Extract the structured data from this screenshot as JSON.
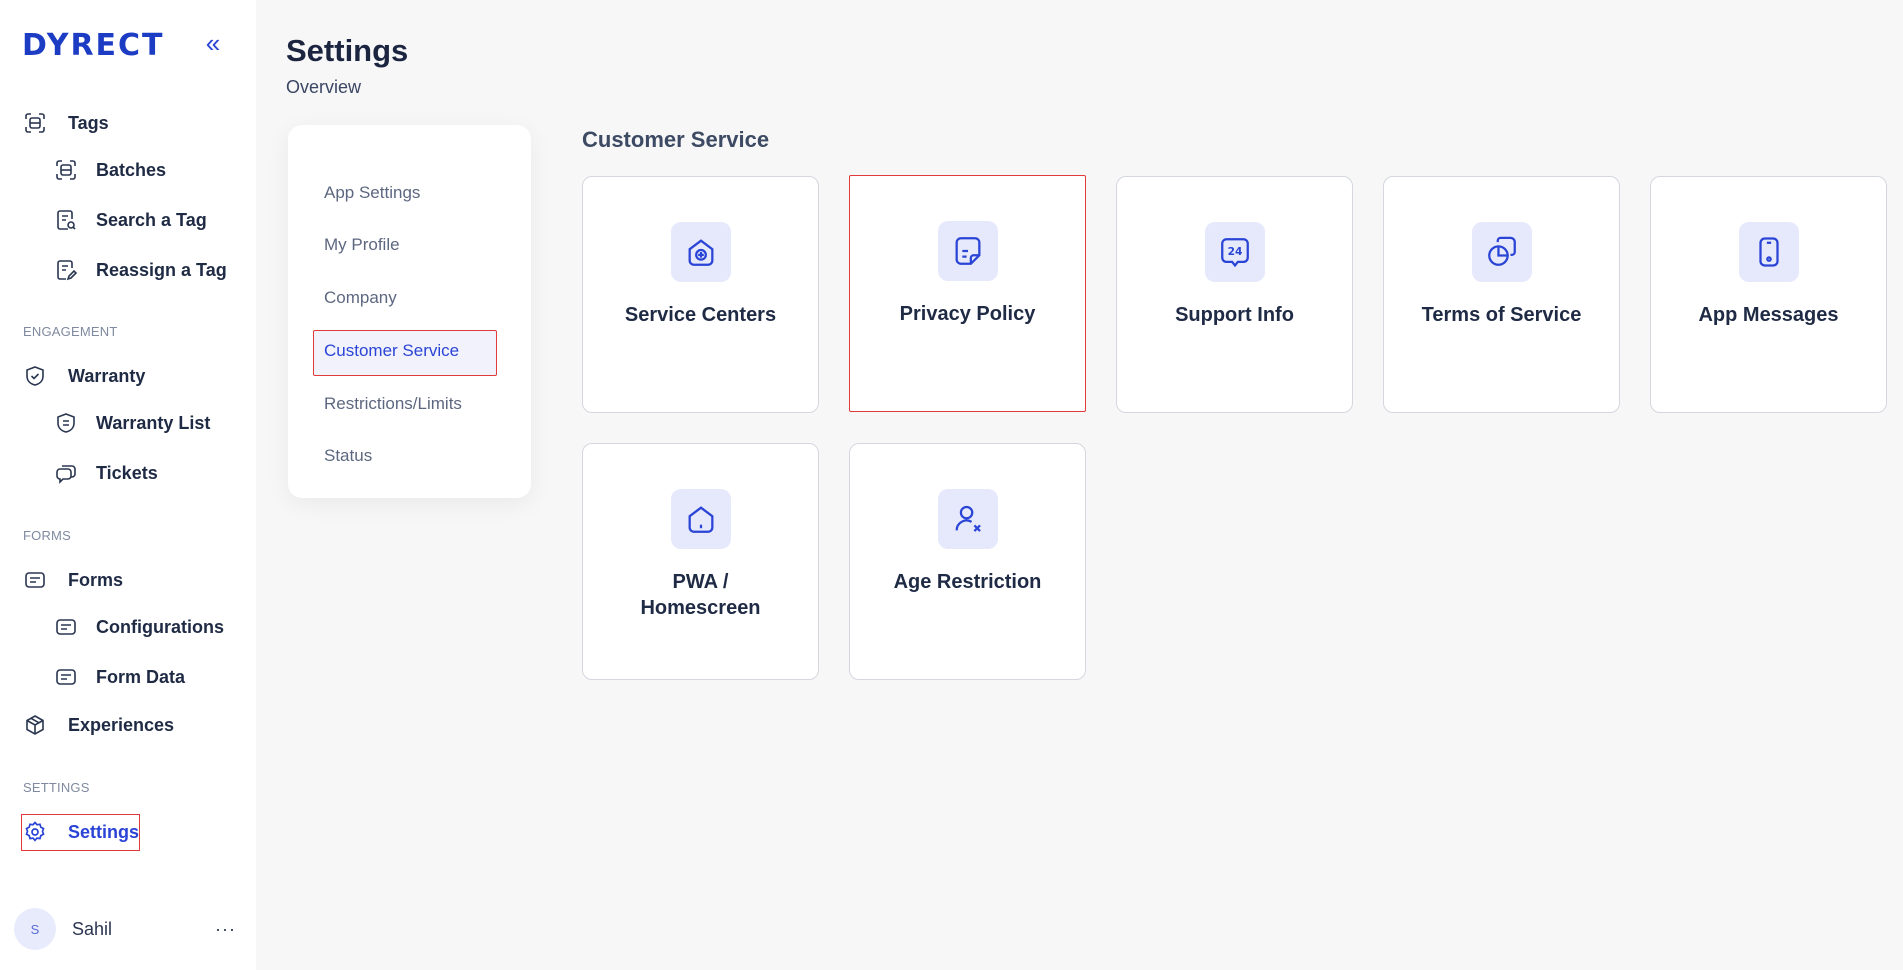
{
  "brand": {
    "logo": "DYRECT"
  },
  "sidebar": {
    "items": [
      {
        "label": "Tags"
      },
      {
        "label": "Batches"
      },
      {
        "label": "Search a Tag"
      },
      {
        "label": "Reassign a Tag"
      },
      {
        "label": "Warranty"
      },
      {
        "label": "Warranty List"
      },
      {
        "label": "Tickets"
      },
      {
        "label": "Forms"
      },
      {
        "label": "Configurations"
      },
      {
        "label": "Form Data"
      },
      {
        "label": "Experiences"
      },
      {
        "label": "Settings"
      }
    ],
    "sections": [
      "ENGAGEMENT",
      "FORMS",
      "SETTINGS"
    ],
    "user": {
      "initial": "S",
      "name": "Sahil",
      "more": "···"
    }
  },
  "header": {
    "title": "Settings",
    "subtitle": "Overview"
  },
  "settings_menu": {
    "items": [
      "App Settings",
      "My Profile",
      "Company",
      "Customer Service",
      "Restrictions/Limits",
      "Status"
    ],
    "active": "Customer Service"
  },
  "content": {
    "section_title": "Customer Service",
    "cards": [
      {
        "label": "Service Centers",
        "icon": "home-plus-icon"
      },
      {
        "label": "Privacy Policy",
        "icon": "document-icon"
      },
      {
        "label": "Support Info",
        "icon": "24-hour-support-icon"
      },
      {
        "label": "Terms of Service",
        "icon": "documents-icon"
      },
      {
        "label": "App Messages",
        "icon": "mobile-icon"
      },
      {
        "label": "PWA / Homescreen",
        "icon": "home-icon"
      },
      {
        "label": "Age Restriction",
        "icon": "user-remove-icon"
      }
    ]
  },
  "colors": {
    "accent": "#2a44d6",
    "highlight_border": "#e03a3a",
    "icon_bg": "#e6e9fb"
  }
}
